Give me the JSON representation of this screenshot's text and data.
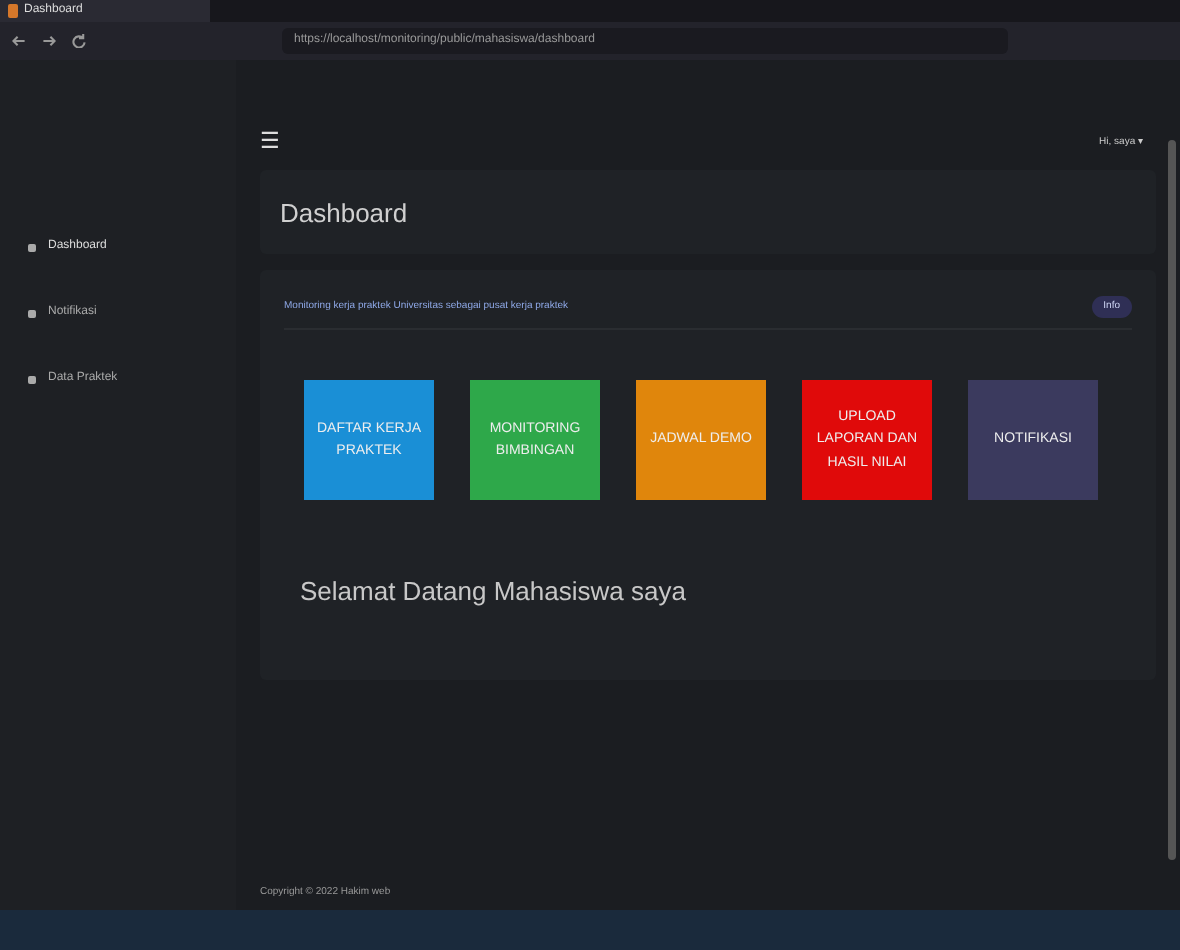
{
  "browser": {
    "tab_title": "Dashboard",
    "address": "https://localhost/monitoring/public/mahasiswa/dashboard"
  },
  "sidebar": {
    "items": [
      {
        "label": "Dashboard",
        "selected": true
      },
      {
        "label": "Notifikasi",
        "selected": false
      },
      {
        "label": "Data Praktek",
        "selected": false
      }
    ]
  },
  "topbar": {
    "menu_icon": "☰",
    "user": "Hi, saya ▾"
  },
  "page_title": "Dashboard",
  "info": {
    "text": "Monitoring kerja praktek Universitas sebagai pusat kerja praktek",
    "button": "Info"
  },
  "tiles": [
    {
      "label": "DAFTAR KERJA PRAKTEK",
      "color": "#1a8fd6"
    },
    {
      "label": "MONITORING BIMBINGAN",
      "color": "#2ea84a"
    },
    {
      "label": "JADWAL DEMO",
      "color": "#e0860c"
    },
    {
      "label": "UPLOAD LAPORAN DAN HASIL NILAI",
      "color": "#e00a0a"
    },
    {
      "label": "NOTIFIKASI",
      "color": "#3b3a5e"
    }
  ],
  "welcome": "Selamat Datang Mahasiswa saya",
  "footer": "Copyright © 2022 Hakim web"
}
